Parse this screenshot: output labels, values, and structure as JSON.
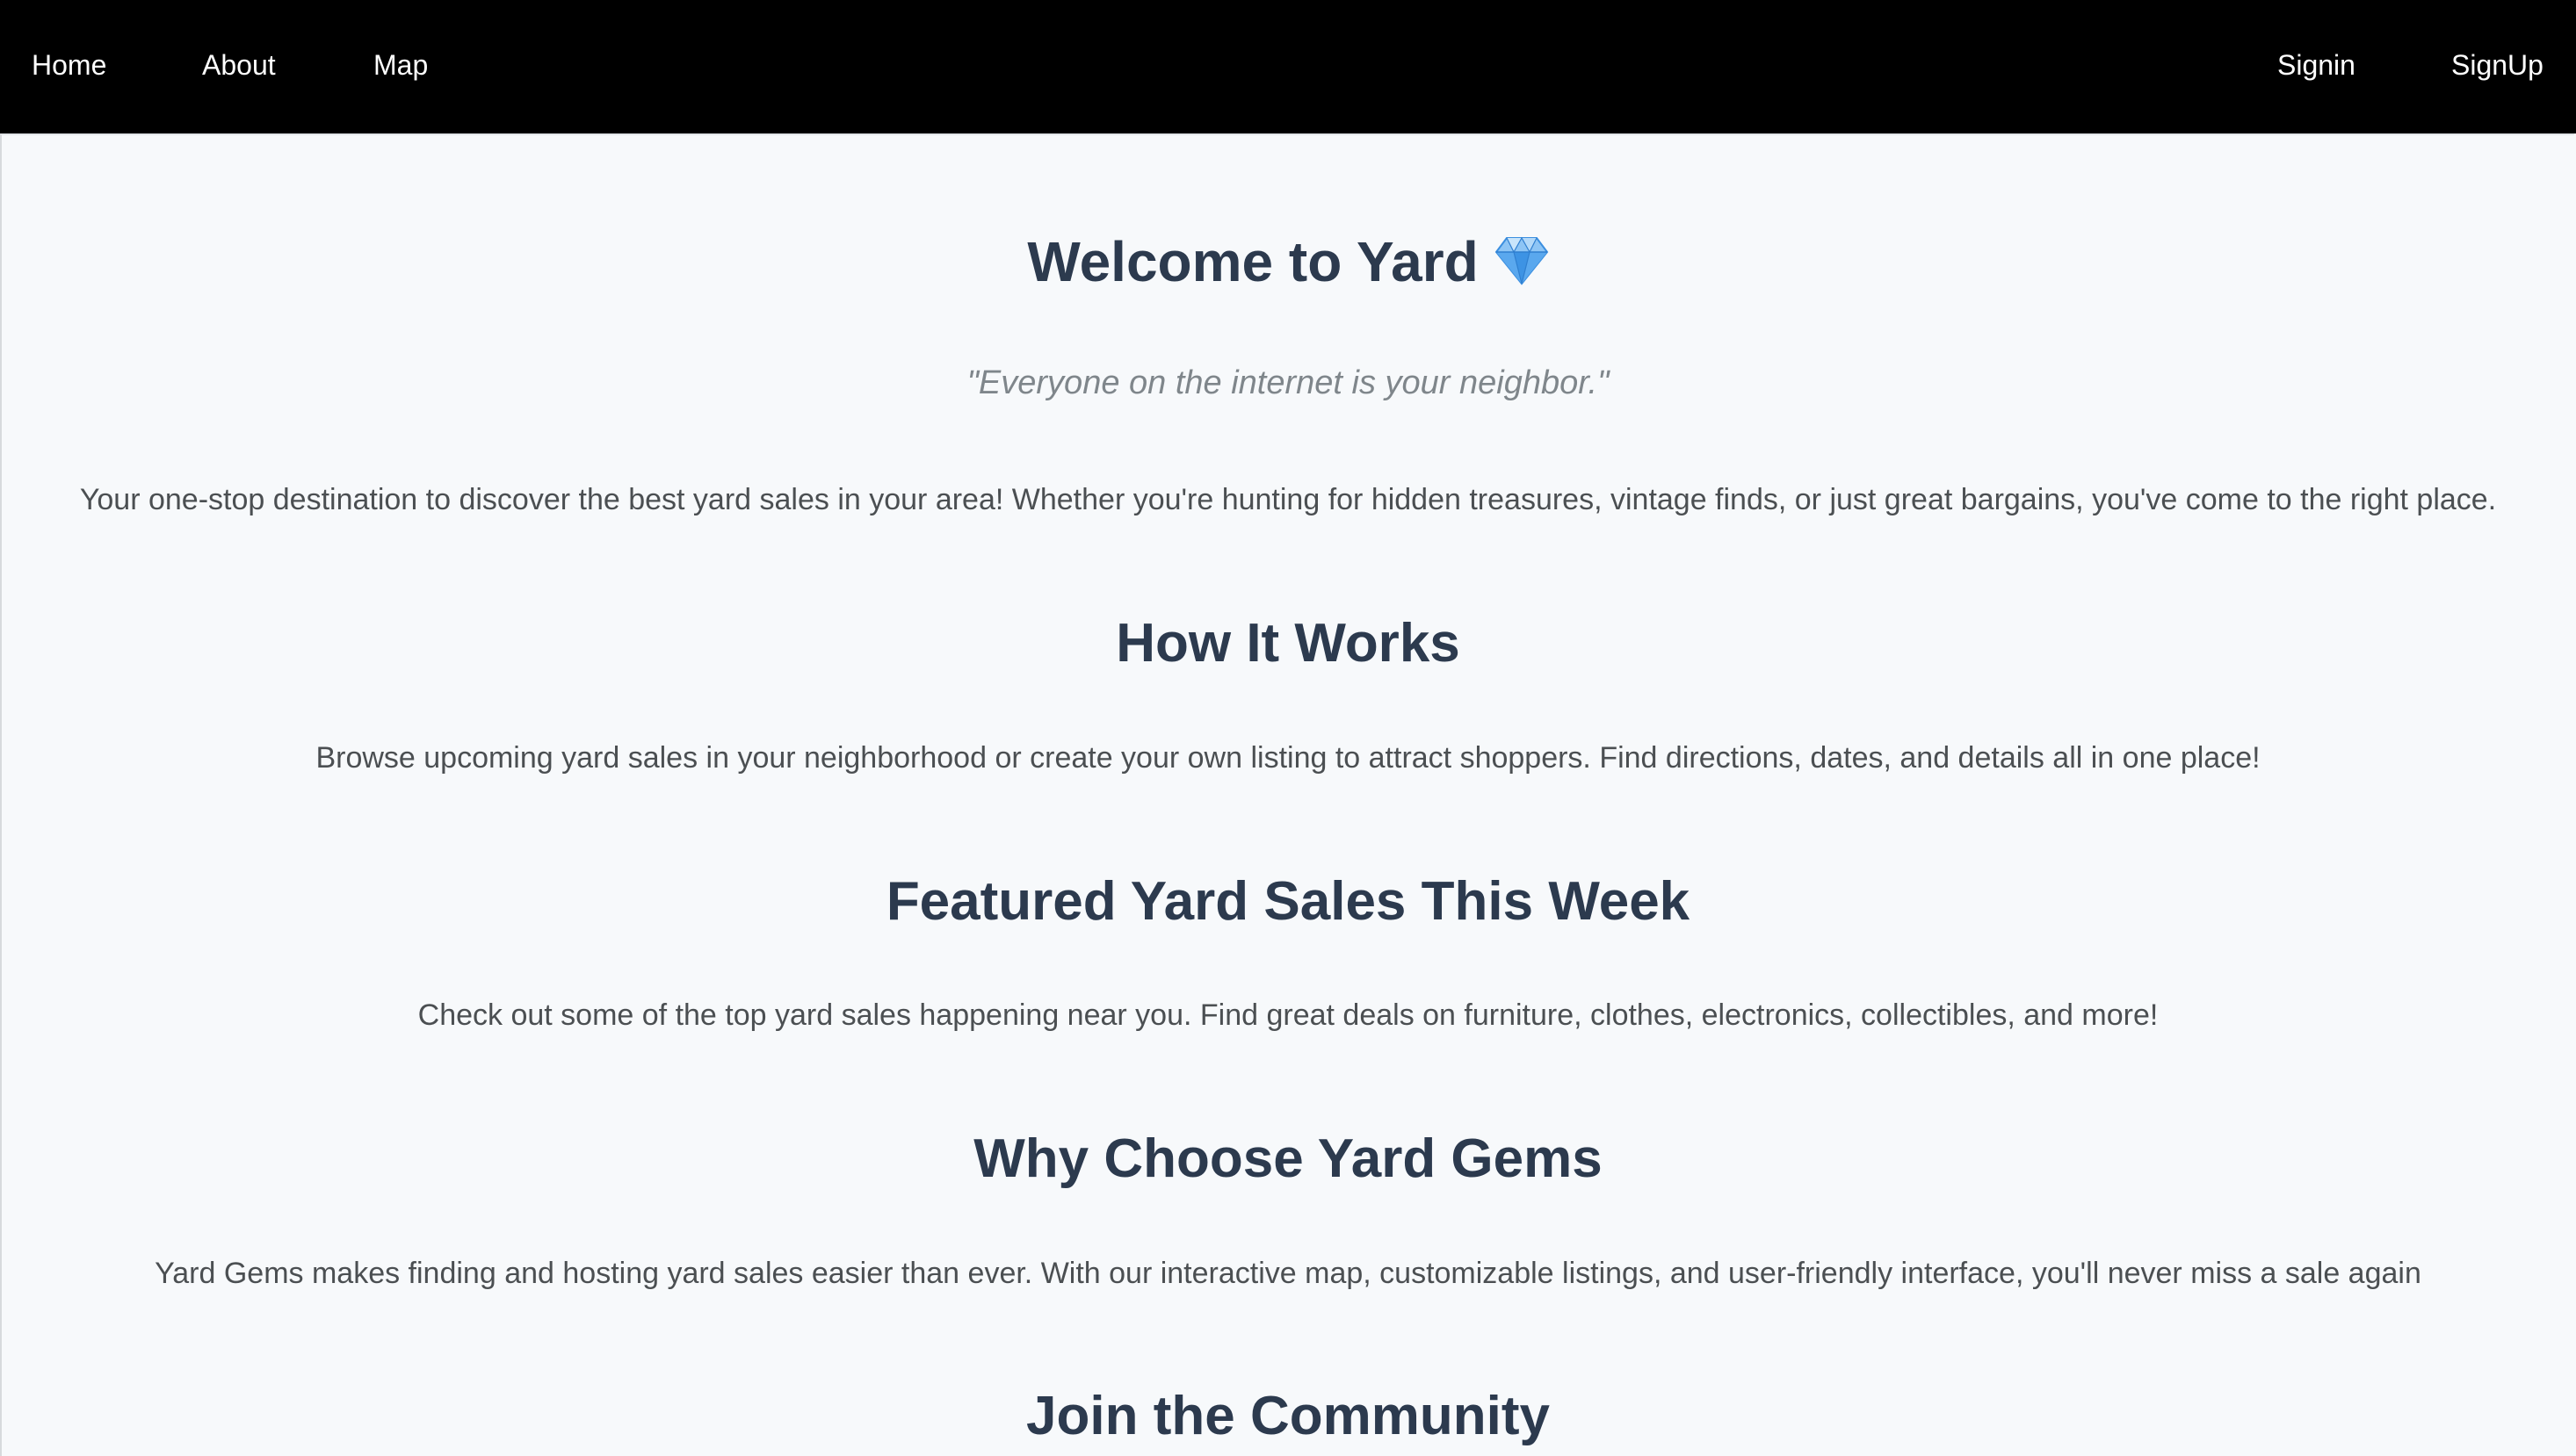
{
  "nav": {
    "home": "Home",
    "about": "About",
    "map": "Map",
    "signin": "Signin",
    "signup": "SignUp"
  },
  "hero": {
    "title": "Welcome to Yard",
    "gem_icon": "gem-icon",
    "tagline": "\"Everyone on the internet is your neighbor.\"",
    "intro": "Your one-stop destination to discover the best yard sales in your area! Whether you're hunting for hidden treasures, vintage finds, or just great bargains, you've come to the right place."
  },
  "sections": {
    "how_title": "How It Works",
    "how_text": "Browse upcoming yard sales in your neighborhood or create your own listing to attract shoppers. Find directions, dates, and details all in one place!",
    "featured_title": "Featured Yard Sales This Week",
    "featured_text": "Check out some of the top yard sales happening near you. Find great deals on furniture, clothes, electronics, collectibles, and more!",
    "why_title": "Why Choose Yard Gems",
    "why_text": "Yard Gems makes finding and hosting yard sales easier than ever. With our interactive map, customizable listings, and user-friendly interface, you'll never miss a sale again",
    "join_title": "Join the Community"
  },
  "colors": {
    "nav_bg": "#000000",
    "heading": "#2c3a4e",
    "body_text": "#4b4f52",
    "quote": "#7f868b",
    "page_bg": "#f7f9fb"
  }
}
